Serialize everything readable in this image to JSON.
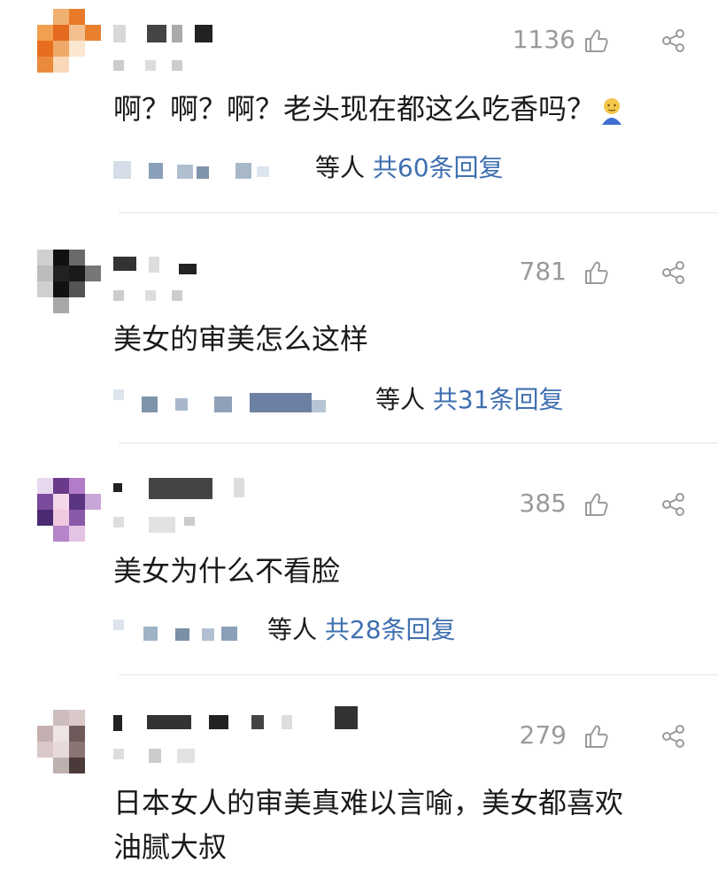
{
  "colors": {
    "text": "#1a1a1a",
    "muted": "#9a9a9a",
    "link": "#3f6fb0",
    "divider": "#e6e6e6"
  },
  "icons": {
    "like": "thumb-up-icon",
    "share": "share-icon"
  },
  "comments": [
    {
      "likes": "1136",
      "text": "啊？啊？啊？老头现在都这么吃香吗？",
      "emoji": "face-emoji",
      "reply_who": "等人",
      "reply_count": "共60条回复"
    },
    {
      "likes": "781",
      "text": "美女的审美怎么这样",
      "reply_who": "等人",
      "reply_count": "共31条回复"
    },
    {
      "likes": "385",
      "text": "美女为什么不看脸",
      "reply_who": "等人",
      "reply_count": "共28条回复"
    },
    {
      "likes": "279",
      "text_line1": "日本女人的审美真难以言喻，美女都喜欢",
      "text_line2": "油腻大叔"
    }
  ]
}
